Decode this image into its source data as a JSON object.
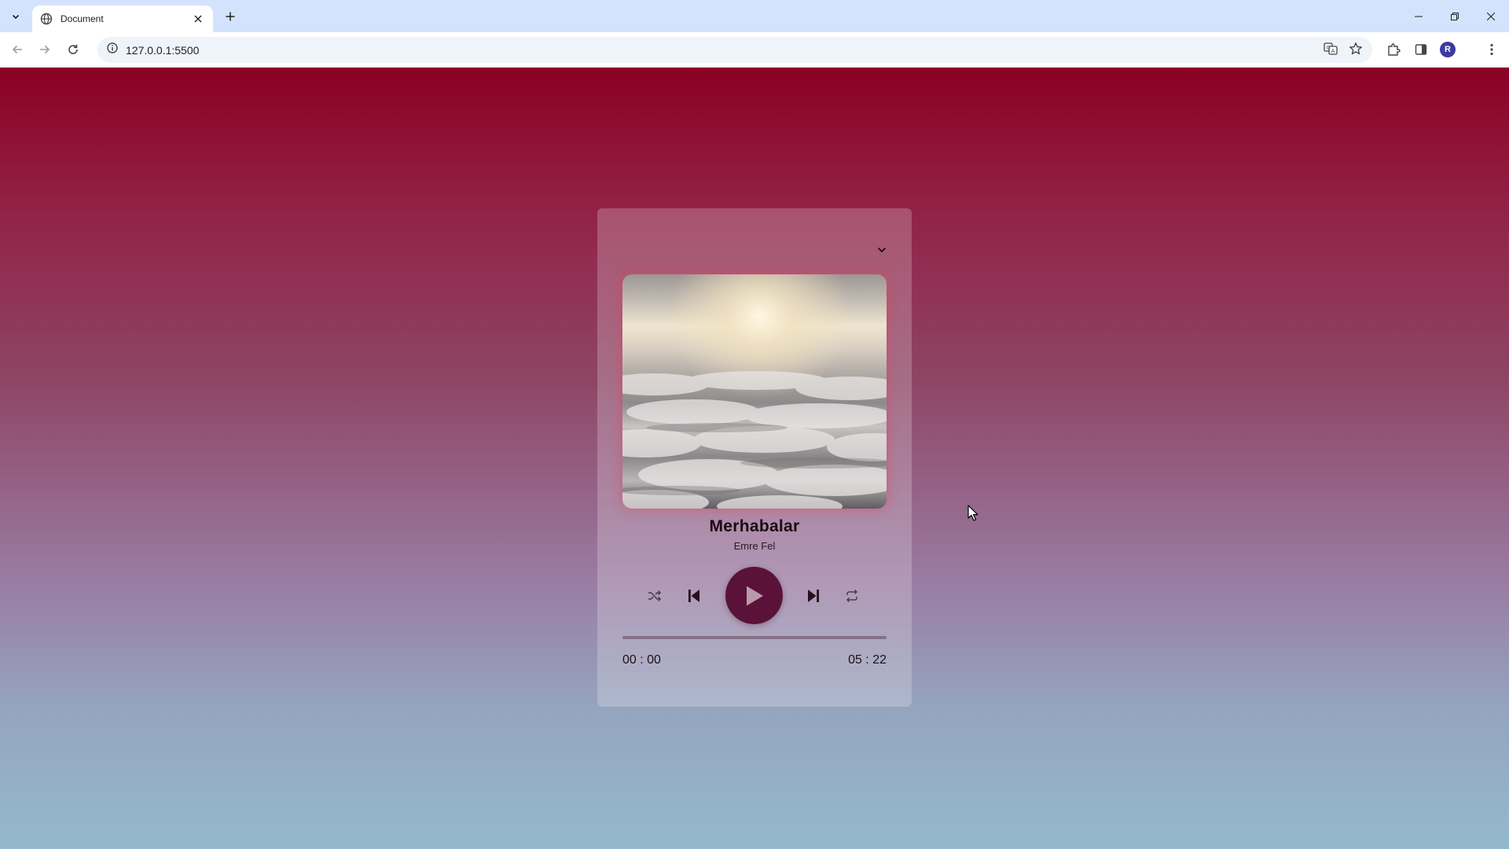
{
  "browser": {
    "tab_title": "Document",
    "url": "127.0.0.1:5500",
    "profile_initial": "R"
  },
  "player": {
    "title": "Merhabalar",
    "artist": "Emre Fel",
    "current_time": "00 : 00",
    "duration": "05 : 22",
    "progress": 0,
    "accent_color": "#5b1238"
  }
}
